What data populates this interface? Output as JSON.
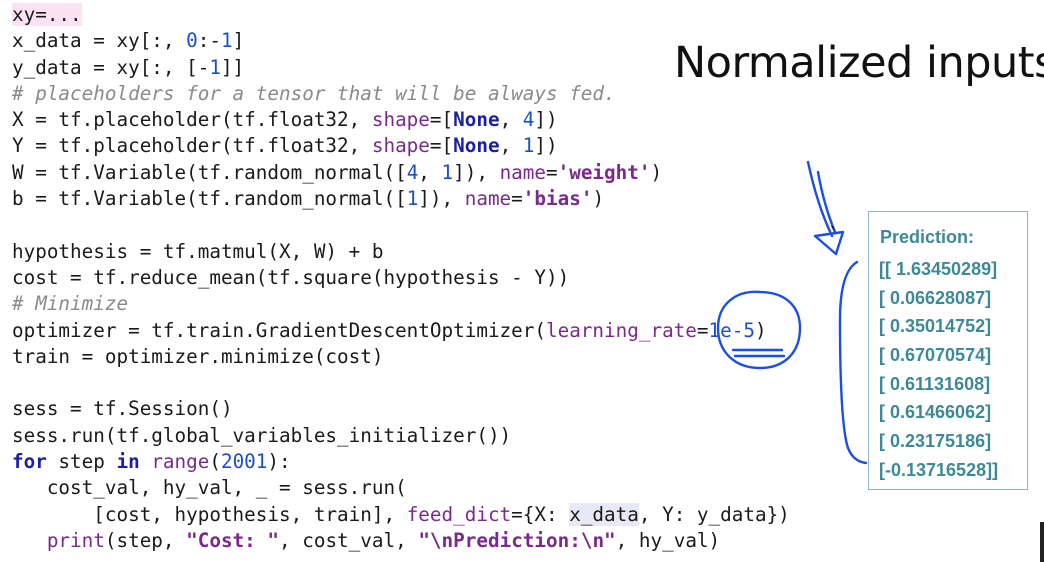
{
  "title": "Normalized inputs",
  "code_lines": [
    [
      {
        "t": "xy=...",
        "c": "hl"
      }
    ],
    [
      {
        "t": "x_data"
      },
      {
        "t": " = xy[:, "
      },
      {
        "t": "0",
        "c": "num"
      },
      {
        "t": ":-"
      },
      {
        "t": "1",
        "c": "num"
      },
      {
        "t": "]"
      }
    ],
    [
      {
        "t": "y_data = xy[:, [-"
      },
      {
        "t": "1",
        "c": "num"
      },
      {
        "t": "]]"
      }
    ],
    [
      {
        "t": "# placeholders for a tensor that will be always fed.",
        "c": "comment"
      }
    ],
    [
      {
        "t": "X = tf.placeholder(tf.float32, "
      },
      {
        "t": "shape",
        "c": "param"
      },
      {
        "t": "=["
      },
      {
        "t": "None",
        "c": "kw"
      },
      {
        "t": ", "
      },
      {
        "t": "4",
        "c": "num"
      },
      {
        "t": "])"
      }
    ],
    [
      {
        "t": "Y = tf.placeholder(tf.float32, "
      },
      {
        "t": "shape",
        "c": "param"
      },
      {
        "t": "=["
      },
      {
        "t": "None",
        "c": "kw"
      },
      {
        "t": ", "
      },
      {
        "t": "1",
        "c": "num"
      },
      {
        "t": "])"
      }
    ],
    [
      {
        "t": "W = tf.Variable(tf.random_normal([",
        "c": ""
      },
      {
        "t": "4",
        "c": "num"
      },
      {
        "t": ", "
      },
      {
        "t": "1",
        "c": "num"
      },
      {
        "t": "]), "
      },
      {
        "t": "name",
        "c": "param"
      },
      {
        "t": "="
      },
      {
        "t": "'weight'",
        "c": "str"
      },
      {
        "t": ")"
      }
    ],
    [
      {
        "t": "b = tf.Variable(tf.random_normal([",
        "c": ""
      },
      {
        "t": "1",
        "c": "num"
      },
      {
        "t": "]), "
      },
      {
        "t": "name",
        "c": "param"
      },
      {
        "t": "="
      },
      {
        "t": "'bias'",
        "c": "str"
      },
      {
        "t": ")"
      }
    ],
    [],
    [
      {
        "t": "hypothesis = tf.matmul(X, W) + b"
      }
    ],
    [
      {
        "t": "cost = tf.reduce_mean(tf.square(hypothesis - Y))"
      }
    ],
    [
      {
        "t": "# Minimize",
        "c": "comment"
      }
    ],
    [
      {
        "t": "optimizer = tf.train.GradientDescentOptimizer("
      },
      {
        "t": "learning_rate",
        "c": "param"
      },
      {
        "t": "="
      },
      {
        "t": "1e-5",
        "c": "num"
      },
      {
        "t": ")"
      }
    ],
    [
      {
        "t": "train = optimizer.minimize(cost)"
      }
    ],
    [],
    [
      {
        "t": "sess = tf.Session()"
      }
    ],
    [
      {
        "t": "sess.run(tf.global_variables_initializer())"
      }
    ],
    [
      {
        "t": "for",
        "c": "kw"
      },
      {
        "t": " step "
      },
      {
        "t": "in",
        "c": "kw"
      },
      {
        "t": " "
      },
      {
        "t": "range",
        "c": "param"
      },
      {
        "t": "("
      },
      {
        "t": "2001",
        "c": "num"
      },
      {
        "t": "):"
      }
    ],
    [
      {
        "t": "   cost_val, hy_val, _ = sess.run("
      }
    ],
    [
      {
        "t": "       [cost, hypothesis, train], "
      },
      {
        "t": "feed_dict",
        "c": "param"
      },
      {
        "t": "={X: "
      },
      {
        "t": "x_data",
        "c": "hl2"
      },
      {
        "t": ", Y: y_data})"
      }
    ],
    [
      {
        "t": "   "
      },
      {
        "t": "print",
        "c": "param"
      },
      {
        "t": "(step, "
      },
      {
        "t": "\"Cost: \"",
        "c": "str"
      },
      {
        "t": ", cost_val, "
      },
      {
        "t": "\"\\nPrediction:\\n\"",
        "c": "str"
      },
      {
        "t": ", hy_val)"
      }
    ]
  ],
  "prediction": {
    "title": "Prediction:",
    "rows": [
      "[[ 1.63450289]",
      "[ 0.06628087]",
      "[ 0.35014752]",
      "[ 0.67070574]",
      "[ 0.61131608]",
      "[ 0.61466062]",
      "[ 0.23175186]",
      "[-0.13716528]]"
    ]
  },
  "colors": {
    "annotation_ink": "#1b4fe0",
    "prediction_text": "#3c8a96",
    "prediction_border": "#8fb4c9"
  }
}
